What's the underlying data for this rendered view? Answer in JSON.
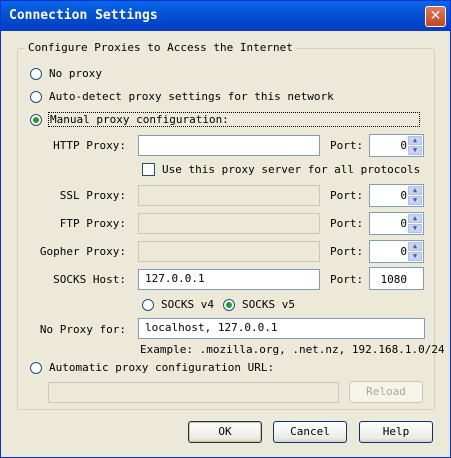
{
  "window": {
    "title": "Connection Settings",
    "close_glyph": "✕"
  },
  "group": {
    "legend": "Configure Proxies to Access the Internet"
  },
  "options": {
    "no_proxy": "No proxy",
    "auto_detect": "Auto-detect proxy settings for this network",
    "manual": "Manual proxy configuration:",
    "auto_url": "Automatic proxy configuration URL:",
    "selected": "manual"
  },
  "http": {
    "label": "HTTP Proxy:",
    "value": "",
    "port_label": "Port:",
    "port": "0"
  },
  "use_all": {
    "label": "Use this proxy server for all protocols",
    "checked": false
  },
  "ssl": {
    "label": "SSL Proxy:",
    "value": "",
    "port_label": "Port:",
    "port": "0"
  },
  "ftp": {
    "label": "FTP Proxy:",
    "value": "",
    "port_label": "Port:",
    "port": "0"
  },
  "gopher": {
    "label": "Gopher Proxy:",
    "value": "",
    "port_label": "Port:",
    "port": "0"
  },
  "socks": {
    "label": "SOCKS Host:",
    "value": "127.0.0.1",
    "port_label": "Port:",
    "port": "1080",
    "v4": "SOCKS v4",
    "v5": "SOCKS v5",
    "selected": "v5"
  },
  "no_proxy_for": {
    "label": "No Proxy for:",
    "value": "localhost, 127.0.0.1",
    "example": "Example: .mozilla.org, .net.nz, 192.168.1.0/24"
  },
  "auto_url": {
    "value": "",
    "reload": "Reload"
  },
  "buttons": {
    "ok": "OK",
    "cancel": "Cancel",
    "help": "Help"
  }
}
